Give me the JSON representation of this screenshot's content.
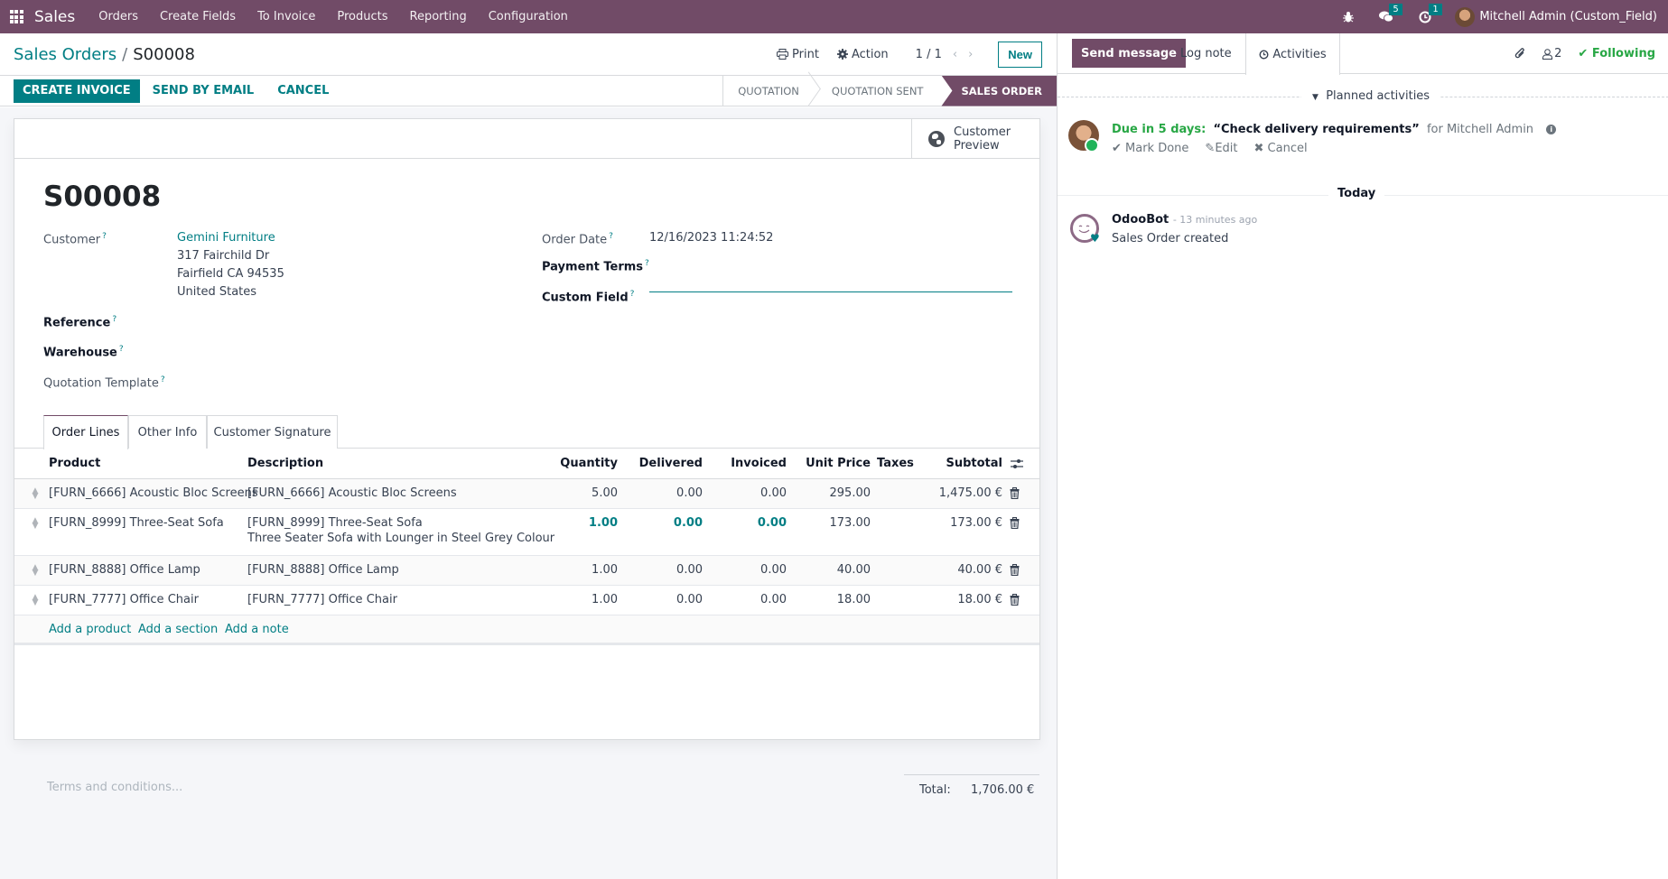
{
  "navbar": {
    "app_name": "Sales",
    "menu": [
      "Orders",
      "Create Fields",
      "To Invoice",
      "Products",
      "Reporting",
      "Configuration"
    ],
    "messages_count": "5",
    "activities_count": "1",
    "user_name": "Mitchell Admin (Custom_Field)",
    "icons": {
      "apps": "apps-grid-icon",
      "debug": "bug-icon",
      "messages": "chat-icon",
      "activities": "clock-icon"
    }
  },
  "control_panel": {
    "breadcrumb_parent": "Sales Orders",
    "breadcrumb_separator": "/",
    "breadcrumb_current": "S00008",
    "print_label": "Print",
    "action_label": "Action",
    "pager": "1 / 1",
    "new_label": "New"
  },
  "statusbar": {
    "buttons": [
      "CREATE INVOICE",
      "SEND BY EMAIL",
      "CANCEL"
    ],
    "stages": [
      "QUOTATION",
      "QUOTATION SENT",
      "SALES ORDER"
    ],
    "active_stage": "SALES ORDER"
  },
  "form": {
    "customer_preview_line1": "Customer",
    "customer_preview_line2": "Preview",
    "title": "S00008",
    "help_marker": "?",
    "fields": {
      "customer_label": "Customer",
      "customer_name": "Gemini Furniture",
      "customer_address": [
        "317 Fairchild Dr",
        "Fairfield CA 94535",
        "United States"
      ],
      "reference_label": "Reference",
      "warehouse_label": "Warehouse",
      "quotation_template_label": "Quotation Template",
      "order_date_label": "Order Date",
      "order_date_value": "12/16/2023 11:24:52",
      "payment_terms_label": "Payment Terms",
      "custom_field_label": "Custom Field",
      "custom_field_value": ""
    },
    "tabs": [
      "Order Lines",
      "Other Info",
      "Customer Signature"
    ],
    "active_tab": "Order Lines",
    "table": {
      "columns": [
        "Product",
        "Description",
        "Quantity",
        "Delivered",
        "Invoiced",
        "Unit Price",
        "Taxes",
        "Subtotal"
      ],
      "rows": [
        {
          "product": "[FURN_6666] Acoustic Bloc Screens",
          "description": "[FURN_6666] Acoustic Bloc Screens",
          "description2": "",
          "quantity": "5.00",
          "delivered": "0.00",
          "invoiced": "0.00",
          "unit_price": "295.00",
          "taxes": "",
          "subtotal": "1,475.00 €"
        },
        {
          "product": "[FURN_8999] Three-Seat Sofa",
          "description": "[FURN_8999] Three-Seat Sofa",
          "description2": "Three Seater Sofa with Lounger in Steel Grey Colour",
          "quantity": "1.00",
          "delivered": "0.00",
          "invoiced": "0.00",
          "unit_price": "173.00",
          "taxes": "",
          "subtotal": "173.00 €"
        },
        {
          "product": "[FURN_8888] Office Lamp",
          "description": "[FURN_8888] Office Lamp",
          "description2": "",
          "quantity": "1.00",
          "delivered": "0.00",
          "invoiced": "0.00",
          "unit_price": "40.00",
          "taxes": "",
          "subtotal": "40.00 €"
        },
        {
          "product": "[FURN_7777] Office Chair",
          "description": "[FURN_7777] Office Chair",
          "description2": "",
          "quantity": "1.00",
          "delivered": "0.00",
          "invoiced": "0.00",
          "unit_price": "18.00",
          "taxes": "",
          "subtotal": "18.00 €"
        }
      ],
      "add_links": [
        "Add a product",
        "Add a section",
        "Add a note"
      ]
    },
    "terms_placeholder": "Terms and conditions...",
    "total_label": "Total:",
    "total_value": "1,706.00 €"
  },
  "chatter": {
    "send_message": "Send message",
    "log_note": "Log note",
    "activities": "Activities",
    "followers_count": "2",
    "following_label": "Following",
    "planned_activities_label": "Planned activities",
    "activity": {
      "due": "Due in 5 days:",
      "summary": "“Check delivery requirements”",
      "assignee": "for Mitchell Admin",
      "actions": [
        "Mark Done",
        "Edit",
        "Cancel"
      ]
    },
    "date_separator": "Today",
    "messages": [
      {
        "author": "OdooBot",
        "time": "- 13 minutes ago",
        "body": "Sales Order created"
      }
    ]
  },
  "colors": {
    "brand": "#714B67",
    "accent": "#017e84",
    "success": "#28a745"
  }
}
